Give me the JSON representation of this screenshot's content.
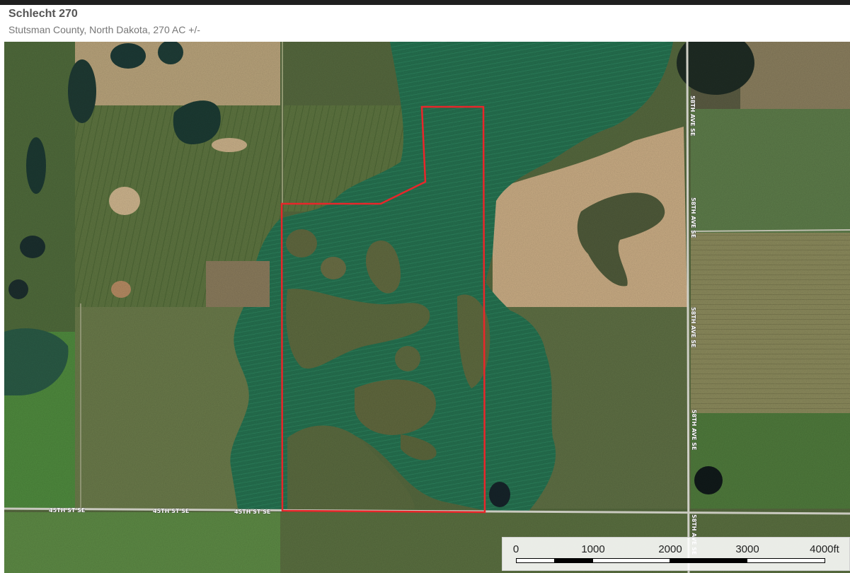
{
  "header": {
    "title": "Schlecht 270",
    "subtitle": "Stutsman County, North Dakota, 270 AC +/-"
  },
  "map": {
    "imagery": "satellite",
    "boundary_color": "#e8262a",
    "roads": {
      "south_road": [
        "45TH ST SE",
        "45TH ST SE",
        "45TH ST SE"
      ],
      "east_road": [
        "58TH AVE SE",
        "58TH AVE SE",
        "58TH AVE SE",
        "58TH AVE SE",
        "58TH AVE SE"
      ]
    }
  },
  "scale": {
    "labels": [
      "0",
      "1000",
      "2000",
      "3000",
      "4000ft"
    ]
  }
}
